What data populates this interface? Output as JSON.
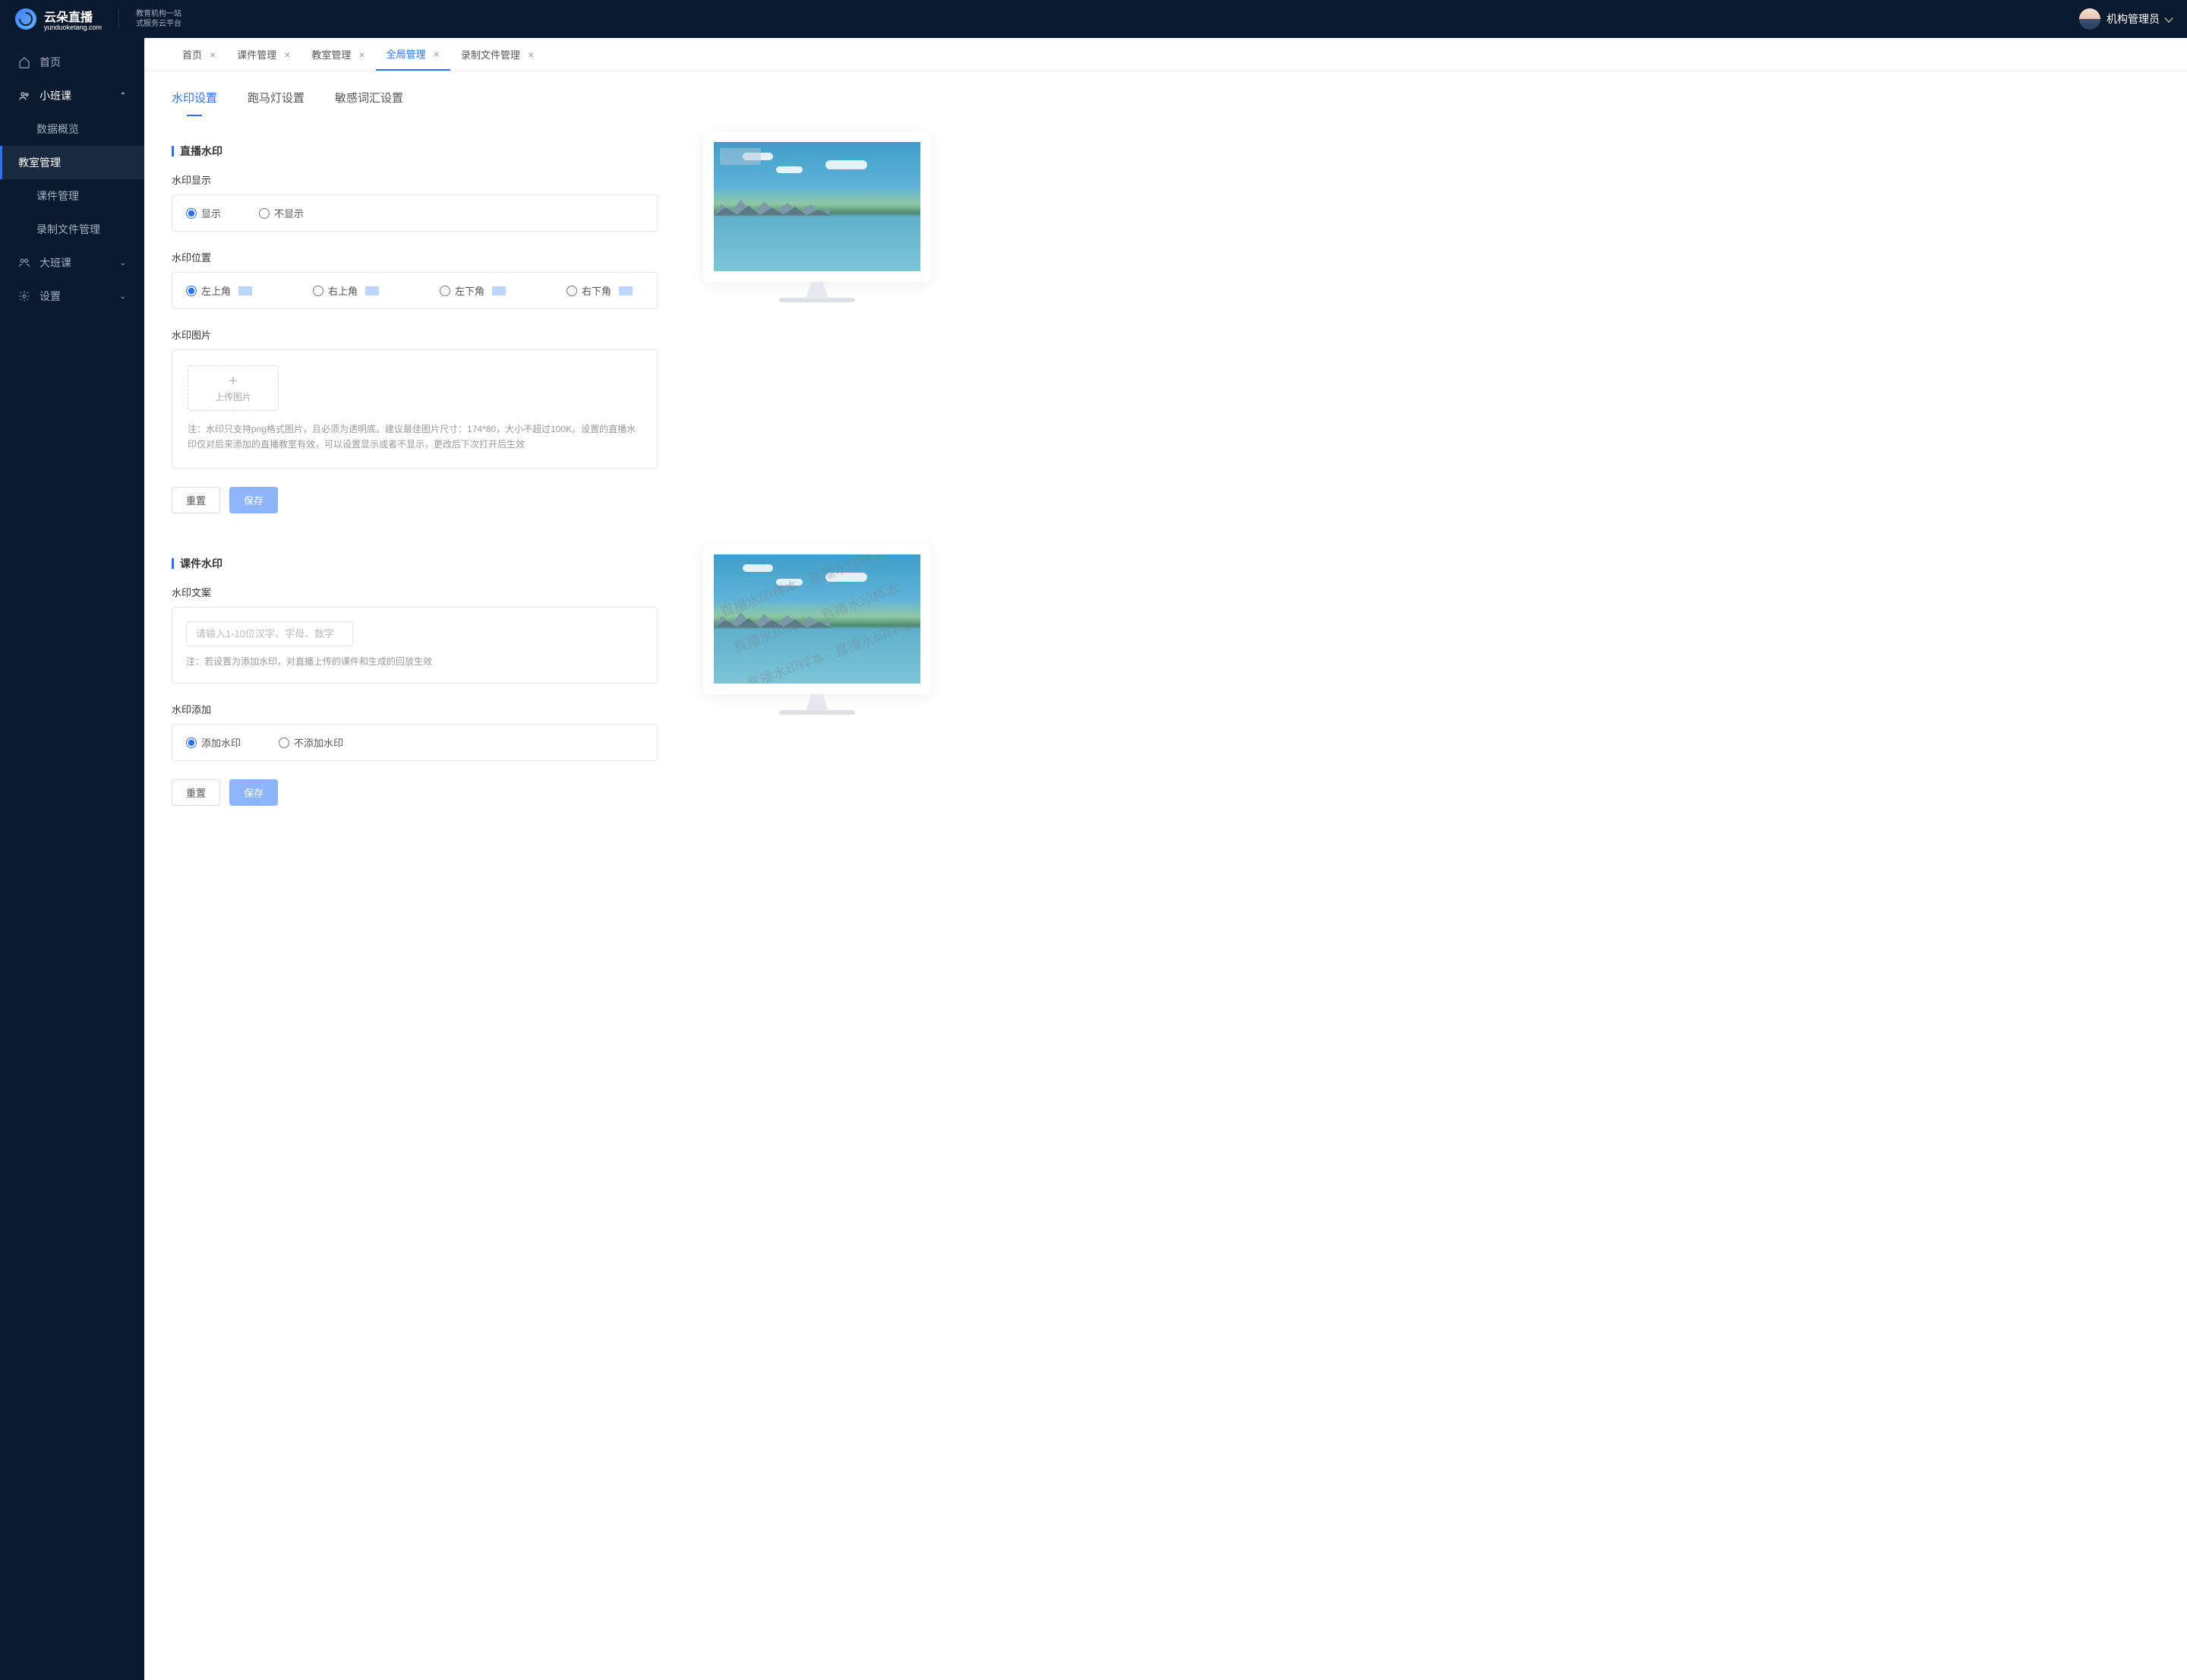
{
  "brand": {
    "name": "云朵直播",
    "sub": "yunduoketang.com",
    "tagline1": "教育机构一站",
    "tagline2": "式服务云平台"
  },
  "user": {
    "name": "机构管理员"
  },
  "sidebar": {
    "home": "首页",
    "smallclass": {
      "label": "小班课",
      "items": [
        "数据概览",
        "教室管理",
        "课件管理",
        "录制文件管理"
      ]
    },
    "bigclass": "大班课",
    "settings": "设置"
  },
  "tabs": [
    {
      "label": "首页",
      "active": false,
      "closable": true
    },
    {
      "label": "课件管理",
      "active": false,
      "closable": true
    },
    {
      "label": "教室管理",
      "active": false,
      "closable": true
    },
    {
      "label": "全局管理",
      "active": true,
      "closable": true
    },
    {
      "label": "录制文件管理",
      "active": false,
      "closable": true
    }
  ],
  "inner_tabs": [
    "水印设置",
    "跑马灯设置",
    "敏感词汇设置"
  ],
  "sections": {
    "live": {
      "title": "直播水印",
      "display_label": "水印显示",
      "display_options": [
        "显示",
        "不显示"
      ],
      "position_label": "水印位置",
      "position_options": [
        "左上角",
        "右上角",
        "左下角",
        "右下角"
      ],
      "image_label": "水印图片",
      "upload_text": "上传图片",
      "image_hint": "注：水印只支持png格式图片，且必须为透明底。建议最佳图片尺寸：174*80，大小不超过100K。设置的直播水印仅对后来添加的直播教室有效，可以设置显示或者不显示，更改后下次打开后生效"
    },
    "doc": {
      "title": "课件水印",
      "text_label": "水印文案",
      "text_placeholder": "请输入1-10位汉字、字母、数字",
      "text_hint": "注：若设置为添加水印，对直播上传的课件和生成的回放生效",
      "add_label": "水印添加",
      "add_options": [
        "添加水印",
        "不添加水印"
      ]
    }
  },
  "buttons": {
    "reset": "重置",
    "save": "保存"
  },
  "watermark_sample": "直播水印样本"
}
